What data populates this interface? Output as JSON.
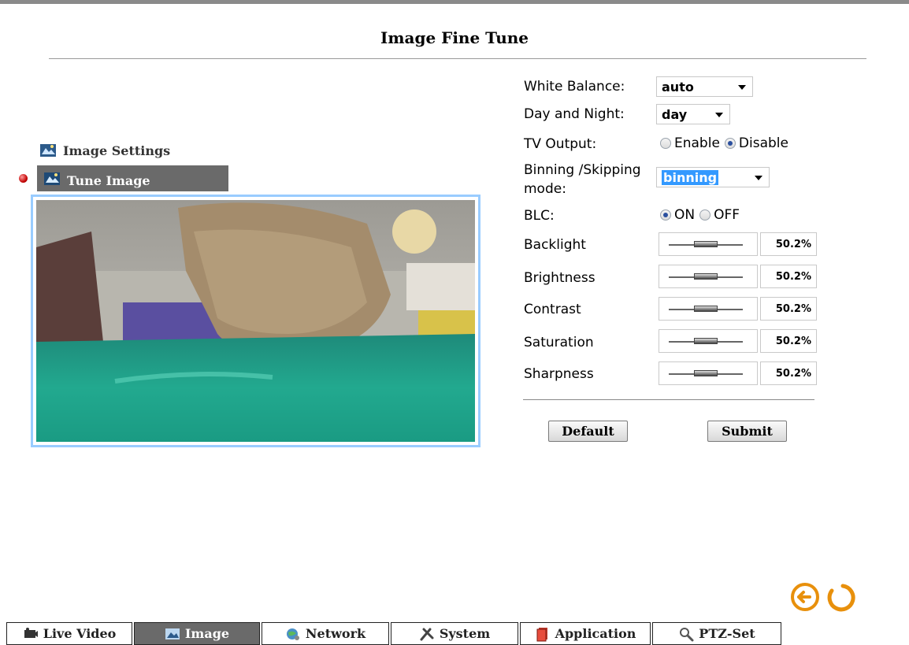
{
  "page": {
    "title": "Image Fine Tune"
  },
  "menu": {
    "items": [
      {
        "label": "Image Settings",
        "icon": "image-settings-icon"
      },
      {
        "label": "Tune Image",
        "icon": "tune-image-icon",
        "selected": true
      }
    ]
  },
  "form": {
    "white_balance": {
      "label": "White Balance:",
      "value": "auto"
    },
    "day_night": {
      "label": "Day and Night:",
      "value": "day"
    },
    "tv_output": {
      "label": "TV Output:",
      "opt1": "Enable",
      "opt2": "Disable",
      "selected": "Disable"
    },
    "binning": {
      "label1": "Binning /Skipping",
      "label2": "mode:",
      "value": "binning"
    },
    "blc": {
      "label": "BLC:",
      "opt1": "ON",
      "opt2": "OFF",
      "selected": "ON"
    },
    "sliders": [
      {
        "label": "Backlight",
        "value": "50.2%"
      },
      {
        "label": "Brightness",
        "value": "50.2%"
      },
      {
        "label": "Contrast",
        "value": "50.2%"
      },
      {
        "label": "Saturation",
        "value": "50.2%"
      },
      {
        "label": "Sharpness",
        "value": "50.2%"
      }
    ],
    "default_button": "Default",
    "submit_button": "Submit"
  },
  "nav": {
    "back_icon": "back-arrow-icon",
    "refresh_icon": "refresh-icon",
    "accent": "#e8900c"
  },
  "tabs": [
    {
      "label": "Live Video",
      "icon": "live-video-icon"
    },
    {
      "label": "Image",
      "icon": "image-icon",
      "active": true
    },
    {
      "label": "Network",
      "icon": "network-icon"
    },
    {
      "label": "System",
      "icon": "system-icon"
    },
    {
      "label": "Application",
      "icon": "application-icon"
    },
    {
      "label": "PTZ-Set",
      "icon": "ptz-set-icon"
    }
  ]
}
